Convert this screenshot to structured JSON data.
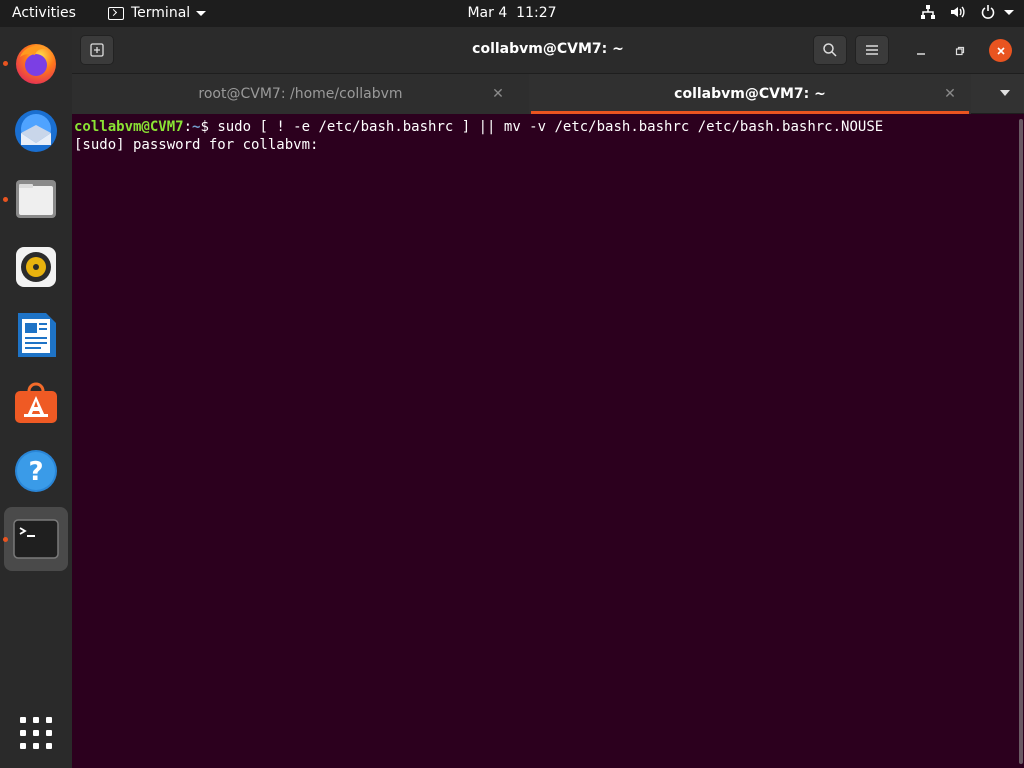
{
  "topbar": {
    "activities": "Activities",
    "app_name": "Terminal",
    "date": "Mar 4",
    "time": "11:27"
  },
  "dock": {
    "items": [
      {
        "name": "firefox-icon",
        "running": true
      },
      {
        "name": "thunderbird-icon",
        "running": false
      },
      {
        "name": "files-icon",
        "running": true
      },
      {
        "name": "rhythmbox-icon",
        "running": false
      },
      {
        "name": "libreoffice-writer-icon",
        "running": false
      },
      {
        "name": "ubuntu-software-icon",
        "running": false
      },
      {
        "name": "help-icon",
        "running": false
      },
      {
        "name": "terminal-icon",
        "running": true
      }
    ]
  },
  "window": {
    "title": "collabvm@CVM7: ~",
    "tabs": [
      {
        "label": "root@CVM7: /home/collabvm",
        "active": false
      },
      {
        "label": "collabvm@CVM7: ~",
        "active": true
      }
    ]
  },
  "terminal": {
    "prompt_user": "collabvm@CVM7",
    "prompt_sep": ":",
    "prompt_path": "~",
    "prompt_symbol": "$ ",
    "command": "sudo [ ! -e /etc/bash.bashrc ] || mv -v /etc/bash.bashrc /etc/bash.bashrc.NOUSE",
    "output_line": "[sudo] password for collabvm:"
  },
  "colors": {
    "accent": "#e95420",
    "terminal_bg": "#2c001e",
    "prompt_user": "#8ae234",
    "prompt_path": "#729fcf"
  }
}
